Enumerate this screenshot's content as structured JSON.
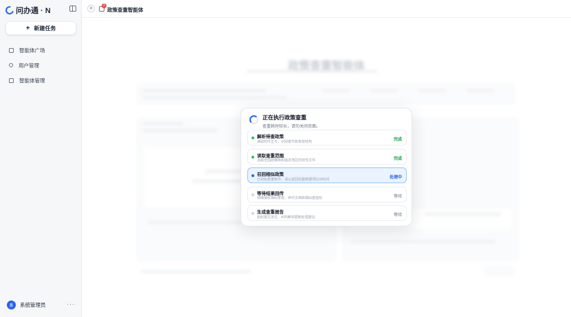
{
  "app": {
    "logo_text": "问办通 · N",
    "new_task_label": "新建任务"
  },
  "sidebar": {
    "items": [
      {
        "label": "智能体广场",
        "icon": "grid-icon"
      },
      {
        "label": "用户管理",
        "icon": "user-icon"
      },
      {
        "label": "智能体管理",
        "icon": "agent-icon"
      }
    ],
    "user": {
      "avatar_text": "系",
      "name": "系统管理员"
    }
  },
  "topbar": {
    "tab_title": "政策查重智能体",
    "badge_count": "2"
  },
  "background_page": {
    "title": "政策查重智能体"
  },
  "modal": {
    "title": "正在执行政策查重",
    "description": "查重耗时较长，请勿关闭页面。",
    "steps": [
      {
        "title": "解析待查政策",
        "desc": "读取附件正文，识别章节和条款结构",
        "status": "完成",
        "state": "done"
      },
      {
        "title": "读取查重范围",
        "desc": "加载全国政策库和指定地区时效性文件",
        "status": "完成",
        "state": "done"
      },
      {
        "title": "召回相似政策",
        "desc": "已初始查重条件，请以返回完整数据项比对时间",
        "status": "处理中",
        "state": "active"
      },
      {
        "title": "等待结果回传",
        "desc": "持续接收相似条款、命中文档和相似度指标",
        "status": "等待",
        "state": "pending"
      },
      {
        "title": "生成查重报告",
        "desc": "组织报文定位、AI判断依据和处理建议",
        "status": "等待",
        "state": "pending"
      }
    ]
  },
  "colors": {
    "accent": "#2563eb",
    "done": "#16a34a",
    "badge": "#ef4444"
  }
}
